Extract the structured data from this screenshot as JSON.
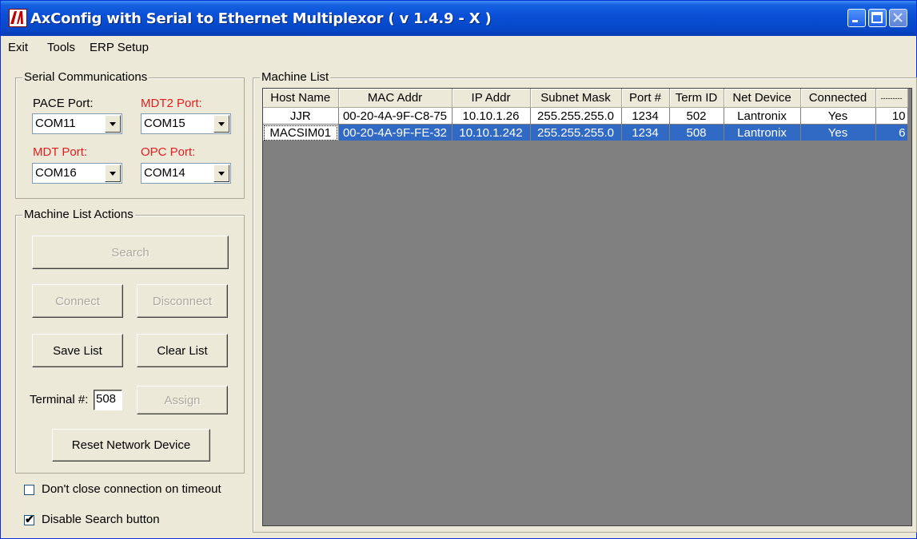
{
  "window": {
    "title": "AxConfig with Serial to Ethernet Multiplexor ( v 1.4.9 - X )"
  },
  "menu": [
    "Exit",
    "Tools",
    "ERP Setup"
  ],
  "serial": {
    "group_label": "Serial Communications",
    "pace_label": "PACE Port:",
    "pace_value": "COM11",
    "mdt2_label": "MDT2 Port:",
    "mdt2_value": "COM15",
    "mdt_label": "MDT Port:",
    "mdt_value": "COM16",
    "opc_label": "OPC Port:",
    "opc_value": "COM14"
  },
  "actions": {
    "group_label": "Machine List Actions",
    "search": "Search",
    "connect": "Connect",
    "disconnect": "Disconnect",
    "save_list": "Save List",
    "clear_list": "Clear List",
    "terminal_label": "Terminal #:",
    "terminal_value": "508",
    "assign": "Assign",
    "reset": "Reset Network Device"
  },
  "options": {
    "dont_close": "Don't close connection on timeout",
    "dont_close_checked": false,
    "disable_search": "Disable Search button",
    "disable_search_checked": true
  },
  "machine_list": {
    "group_label": "Machine List",
    "columns": [
      "Host Name",
      "MAC Addr",
      "IP Addr",
      "Subnet Mask",
      "Port #",
      "Term ID",
      "Net Device",
      "Connected",
      "---------"
    ],
    "rows": [
      [
        "JJR",
        "00-20-4A-9F-C8-75",
        "10.10.1.26",
        "255.255.255.0",
        "1234",
        "502",
        "Lantronix",
        "Yes",
        "10"
      ],
      [
        "MACSIM01",
        "00-20-4A-9F-FE-32",
        "10.10.1.242",
        "255.255.255.0",
        "1234",
        "508",
        "Lantronix",
        "Yes",
        "6"
      ]
    ],
    "selected_row": 1
  },
  "colors": {
    "title_bar": "#0548c8",
    "selection": "#316ac5",
    "red_label": "#e02020"
  }
}
